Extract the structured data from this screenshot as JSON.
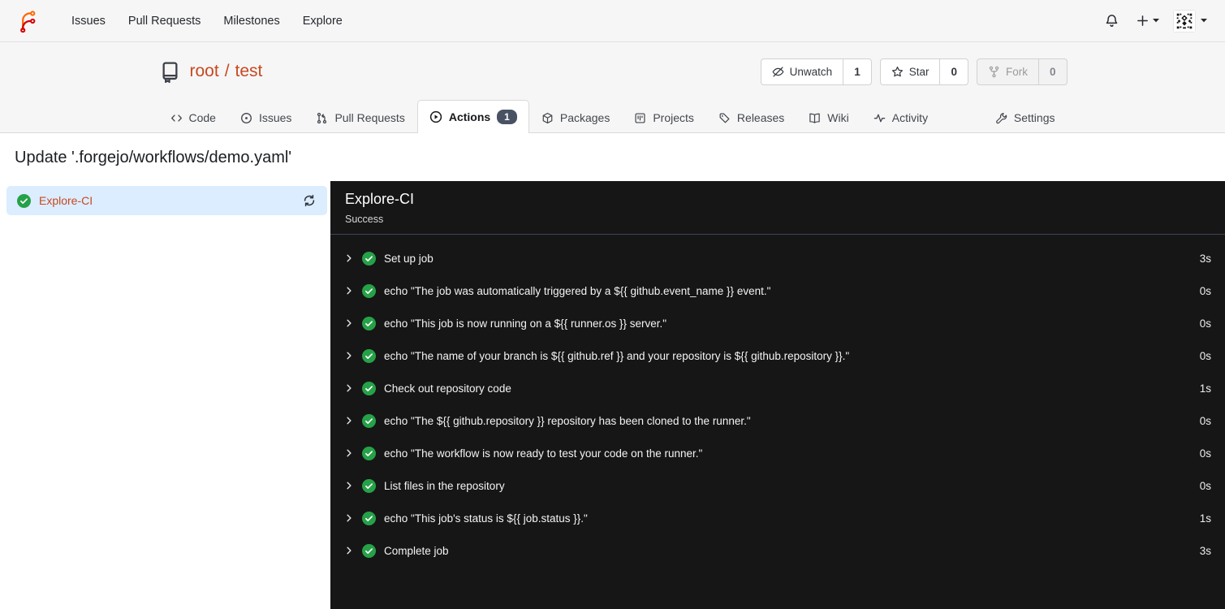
{
  "navbar": {
    "items": [
      {
        "label": "Issues"
      },
      {
        "label": "Pull Requests"
      },
      {
        "label": "Milestones"
      },
      {
        "label": "Explore"
      }
    ]
  },
  "repo": {
    "owner": "root",
    "separator": "/",
    "name": "test",
    "buttons": [
      {
        "label": "Unwatch",
        "count": "1"
      },
      {
        "label": "Star",
        "count": "0"
      },
      {
        "label": "Fork",
        "count": "0",
        "disabled": true
      }
    ]
  },
  "tabs": [
    {
      "label": "Code"
    },
    {
      "label": "Issues"
    },
    {
      "label": "Pull Requests"
    },
    {
      "label": "Actions",
      "badge": "1",
      "active": true
    },
    {
      "label": "Packages"
    },
    {
      "label": "Projects"
    },
    {
      "label": "Releases"
    },
    {
      "label": "Wiki"
    },
    {
      "label": "Activity"
    },
    {
      "label": "Settings"
    }
  ],
  "page": {
    "title": "Update '.forgejo/workflows/demo.yaml'"
  },
  "job_list": [
    {
      "name": "Explore-CI",
      "status": "success",
      "selected": true
    }
  ],
  "panel": {
    "title": "Explore-CI",
    "status": "Success"
  },
  "steps": [
    {
      "name": "Set up job",
      "duration": "3s",
      "status": "success"
    },
    {
      "name": "echo \"The job was automatically triggered by a ${{ github.event_name }} event.\"",
      "duration": "0s",
      "status": "success"
    },
    {
      "name": "echo \"This job is now running on a ${{ runner.os }} server.\"",
      "duration": "0s",
      "status": "success"
    },
    {
      "name": "echo \"The name of your branch is ${{ github.ref }} and your repository is ${{ github.repository }}.\"",
      "duration": "0s",
      "status": "success"
    },
    {
      "name": "Check out repository code",
      "duration": "1s",
      "status": "success"
    },
    {
      "name": "echo \"The ${{ github.repository }} repository has been cloned to the runner.\"",
      "duration": "0s",
      "status": "success"
    },
    {
      "name": "echo \"The workflow is now ready to test your code on the runner.\"",
      "duration": "0s",
      "status": "success"
    },
    {
      "name": "List files in the repository",
      "duration": "0s",
      "status": "success"
    },
    {
      "name": "echo \"This job's status is ${{ job.status }}.\"",
      "duration": "1s",
      "status": "success"
    },
    {
      "name": "Complete job",
      "duration": "3s",
      "status": "success"
    }
  ],
  "icons": {
    "forgejo-logo": "brand mark (orange/red branch curves)",
    "bell-icon": "notifications",
    "plus-icon": "create new",
    "caret-down-icon": "dropdown",
    "avatar": "user identicon",
    "repo-book-icon": "repository",
    "eye-slash-icon": "unwatch",
    "star-icon": "star",
    "fork-icon": "fork",
    "code-icon": "code tab",
    "issue-icon": "issues tab",
    "pull-request-icon": "pull requests tab",
    "play-circle-icon": "actions tab",
    "package-icon": "packages tab",
    "project-icon": "projects tab",
    "tag-icon": "releases tab",
    "book-open-icon": "wiki tab",
    "pulse-icon": "activity tab",
    "wrench-icon": "settings tab",
    "check-circle-icon": "step success",
    "sync-icon": "re-run job",
    "chevron-right-icon": "expand step"
  },
  "colors": {
    "accent_link": "#c7491f",
    "success_green": "#26a148",
    "selected_job_bg": "#dbedff",
    "panel_bg": "#161616",
    "badge_bg": "#485263",
    "header_bg": "#f6f6f7"
  }
}
